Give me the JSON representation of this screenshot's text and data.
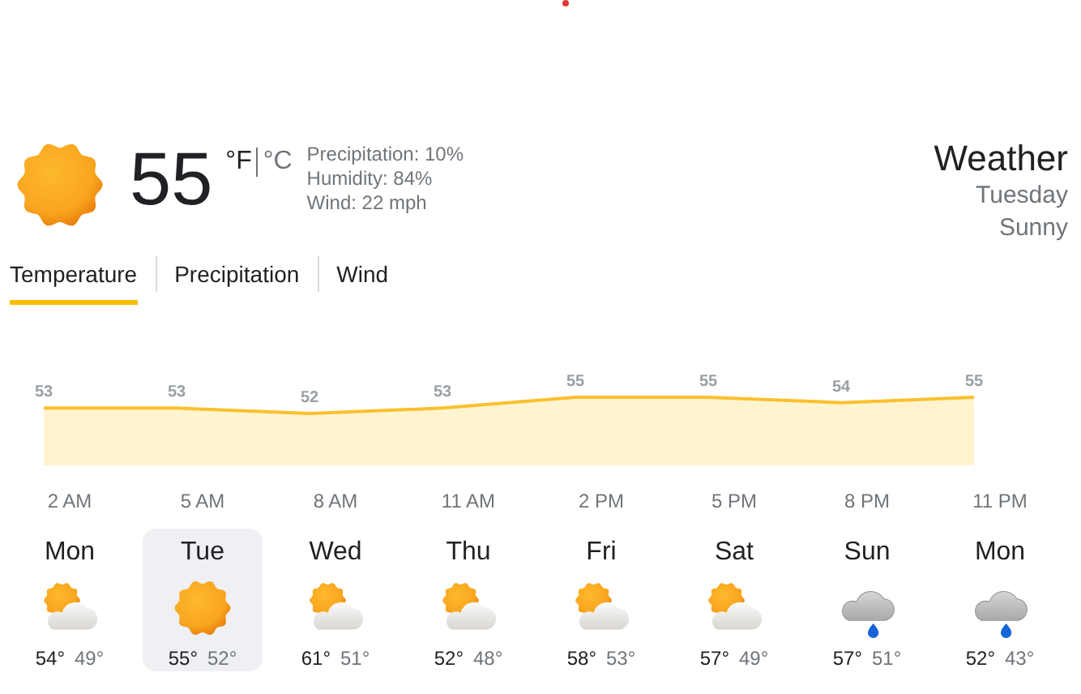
{
  "current": {
    "kind": "sun",
    "temperature": "55",
    "units": [
      {
        "label": "°F",
        "selected": true
      },
      {
        "label": "°C",
        "selected": false
      }
    ],
    "details": [
      "Precipitation: 10%",
      "Humidity: 84%",
      "Wind: 22 mph"
    ]
  },
  "summary": {
    "title": "Weather",
    "day": "Tuesday",
    "condition": "Sunny"
  },
  "tabs": [
    {
      "label": "Temperature",
      "selected": true
    },
    {
      "label": "Precipitation",
      "selected": false
    },
    {
      "label": "Wind",
      "selected": false
    }
  ],
  "chart": {
    "chart_data": {
      "type": "area",
      "series": [
        {
          "color": "#fbc02d",
          "values": [
            53,
            53,
            52,
            53,
            55,
            55,
            54,
            55
          ]
        }
      ],
      "data_labels": true
    },
    "hours": [
      "2 AM",
      "5 AM",
      "8 AM",
      "11 AM",
      "2 PM",
      "5 PM",
      "8 PM",
      "11 PM"
    ]
  },
  "days": [
    {
      "day": "Mon",
      "kind": "partly-cloudy",
      "high": "54°",
      "low": "49°",
      "selected": false
    },
    {
      "day": "Tue",
      "kind": "sun",
      "high": "55°",
      "low": "52°",
      "selected": true
    },
    {
      "day": "Wed",
      "kind": "partly-cloudy",
      "high": "61°",
      "low": "51°",
      "selected": false
    },
    {
      "day": "Thu",
      "kind": "partly-cloudy",
      "high": "52°",
      "low": "48°",
      "selected": false
    },
    {
      "day": "Fri",
      "kind": "partly-cloudy",
      "high": "58°",
      "low": "53°",
      "selected": false
    },
    {
      "day": "Sat",
      "kind": "partly-cloudy",
      "high": "57°",
      "low": "49°",
      "selected": false
    },
    {
      "day": "Sun",
      "kind": "rain",
      "high": "57°",
      "low": "51°",
      "selected": false
    },
    {
      "day": "Mon",
      "kind": "rain",
      "high": "52°",
      "low": "43°",
      "selected": false
    }
  ]
}
